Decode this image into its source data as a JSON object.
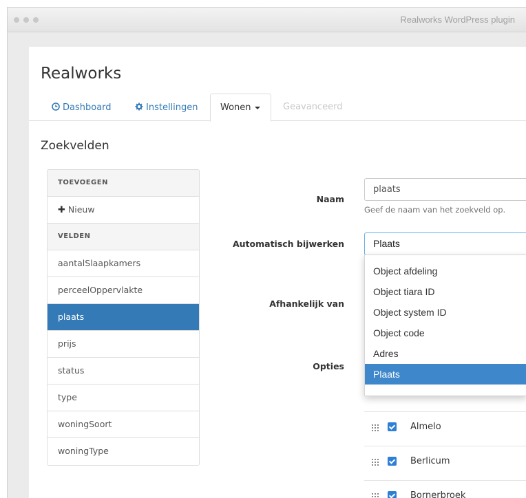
{
  "window": {
    "title": "Realworks WordPress plugin"
  },
  "app": {
    "title": "Realworks"
  },
  "tabs": [
    {
      "label": "Dashboard",
      "icon": "clock-icon"
    },
    {
      "label": "Instellingen",
      "icon": "gear-icon"
    },
    {
      "label": "Wonen",
      "icon": "caret-down-icon",
      "active": true
    },
    {
      "label": "Geavanceerd",
      "disabled": true
    }
  ],
  "section": {
    "title": "Zoekvelden"
  },
  "list": {
    "add_header": "TOEVOEGEN",
    "new_label": "Nieuw",
    "fields_header": "VELDEN",
    "fields": [
      "aantalSlaapkamers",
      "perceelOppervlakte",
      "plaats",
      "prijs",
      "status",
      "type",
      "woningSoort",
      "woningType"
    ],
    "active_field": "plaats"
  },
  "form": {
    "name_label": "Naam",
    "name_value": "plaats",
    "name_help": "Geef de naam van het zoekveld op.",
    "auto_label": "Automatisch bijwerken",
    "auto_value": "Plaats",
    "depends_label": "Afhankelijk van",
    "options_label": "Opties"
  },
  "dropdown": {
    "options": [
      "Object afdeling",
      "Object tiara ID",
      "Object system ID",
      "Object code",
      "Adres",
      "Plaats"
    ],
    "selected": "Plaats"
  },
  "option_rows": [
    {
      "label": "Almelo",
      "checked": true
    },
    {
      "label": "Berlicum",
      "checked": true
    },
    {
      "label": "Bornerbroek",
      "checked": true
    }
  ],
  "colors": {
    "accent": "#337ab7",
    "selected_option": "#3e87cb",
    "checkbox": "#2e7fd6"
  }
}
